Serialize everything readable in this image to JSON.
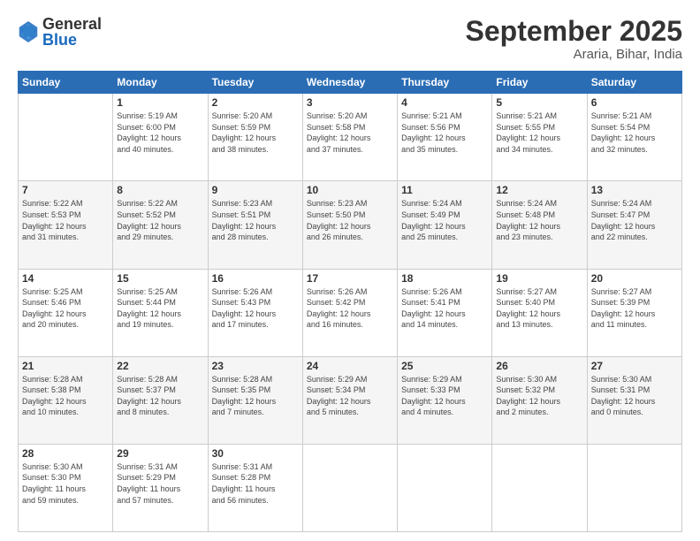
{
  "header": {
    "logo": {
      "general": "General",
      "blue": "Blue"
    },
    "title": "September 2025",
    "location": "Araria, Bihar, India"
  },
  "calendar": {
    "days_of_week": [
      "Sunday",
      "Monday",
      "Tuesday",
      "Wednesday",
      "Thursday",
      "Friday",
      "Saturday"
    ],
    "weeks": [
      [
        {
          "day": "",
          "info": ""
        },
        {
          "day": "1",
          "info": "Sunrise: 5:19 AM\nSunset: 6:00 PM\nDaylight: 12 hours\nand 40 minutes."
        },
        {
          "day": "2",
          "info": "Sunrise: 5:20 AM\nSunset: 5:59 PM\nDaylight: 12 hours\nand 38 minutes."
        },
        {
          "day": "3",
          "info": "Sunrise: 5:20 AM\nSunset: 5:58 PM\nDaylight: 12 hours\nand 37 minutes."
        },
        {
          "day": "4",
          "info": "Sunrise: 5:21 AM\nSunset: 5:56 PM\nDaylight: 12 hours\nand 35 minutes."
        },
        {
          "day": "5",
          "info": "Sunrise: 5:21 AM\nSunset: 5:55 PM\nDaylight: 12 hours\nand 34 minutes."
        },
        {
          "day": "6",
          "info": "Sunrise: 5:21 AM\nSunset: 5:54 PM\nDaylight: 12 hours\nand 32 minutes."
        }
      ],
      [
        {
          "day": "7",
          "info": "Sunrise: 5:22 AM\nSunset: 5:53 PM\nDaylight: 12 hours\nand 31 minutes."
        },
        {
          "day": "8",
          "info": "Sunrise: 5:22 AM\nSunset: 5:52 PM\nDaylight: 12 hours\nand 29 minutes."
        },
        {
          "day": "9",
          "info": "Sunrise: 5:23 AM\nSunset: 5:51 PM\nDaylight: 12 hours\nand 28 minutes."
        },
        {
          "day": "10",
          "info": "Sunrise: 5:23 AM\nSunset: 5:50 PM\nDaylight: 12 hours\nand 26 minutes."
        },
        {
          "day": "11",
          "info": "Sunrise: 5:24 AM\nSunset: 5:49 PM\nDaylight: 12 hours\nand 25 minutes."
        },
        {
          "day": "12",
          "info": "Sunrise: 5:24 AM\nSunset: 5:48 PM\nDaylight: 12 hours\nand 23 minutes."
        },
        {
          "day": "13",
          "info": "Sunrise: 5:24 AM\nSunset: 5:47 PM\nDaylight: 12 hours\nand 22 minutes."
        }
      ],
      [
        {
          "day": "14",
          "info": "Sunrise: 5:25 AM\nSunset: 5:46 PM\nDaylight: 12 hours\nand 20 minutes."
        },
        {
          "day": "15",
          "info": "Sunrise: 5:25 AM\nSunset: 5:44 PM\nDaylight: 12 hours\nand 19 minutes."
        },
        {
          "day": "16",
          "info": "Sunrise: 5:26 AM\nSunset: 5:43 PM\nDaylight: 12 hours\nand 17 minutes."
        },
        {
          "day": "17",
          "info": "Sunrise: 5:26 AM\nSunset: 5:42 PM\nDaylight: 12 hours\nand 16 minutes."
        },
        {
          "day": "18",
          "info": "Sunrise: 5:26 AM\nSunset: 5:41 PM\nDaylight: 12 hours\nand 14 minutes."
        },
        {
          "day": "19",
          "info": "Sunrise: 5:27 AM\nSunset: 5:40 PM\nDaylight: 12 hours\nand 13 minutes."
        },
        {
          "day": "20",
          "info": "Sunrise: 5:27 AM\nSunset: 5:39 PM\nDaylight: 12 hours\nand 11 minutes."
        }
      ],
      [
        {
          "day": "21",
          "info": "Sunrise: 5:28 AM\nSunset: 5:38 PM\nDaylight: 12 hours\nand 10 minutes."
        },
        {
          "day": "22",
          "info": "Sunrise: 5:28 AM\nSunset: 5:37 PM\nDaylight: 12 hours\nand 8 minutes."
        },
        {
          "day": "23",
          "info": "Sunrise: 5:28 AM\nSunset: 5:35 PM\nDaylight: 12 hours\nand 7 minutes."
        },
        {
          "day": "24",
          "info": "Sunrise: 5:29 AM\nSunset: 5:34 PM\nDaylight: 12 hours\nand 5 minutes."
        },
        {
          "day": "25",
          "info": "Sunrise: 5:29 AM\nSunset: 5:33 PM\nDaylight: 12 hours\nand 4 minutes."
        },
        {
          "day": "26",
          "info": "Sunrise: 5:30 AM\nSunset: 5:32 PM\nDaylight: 12 hours\nand 2 minutes."
        },
        {
          "day": "27",
          "info": "Sunrise: 5:30 AM\nSunset: 5:31 PM\nDaylight: 12 hours\nand 0 minutes."
        }
      ],
      [
        {
          "day": "28",
          "info": "Sunrise: 5:30 AM\nSunset: 5:30 PM\nDaylight: 11 hours\nand 59 minutes."
        },
        {
          "day": "29",
          "info": "Sunrise: 5:31 AM\nSunset: 5:29 PM\nDaylight: 11 hours\nand 57 minutes."
        },
        {
          "day": "30",
          "info": "Sunrise: 5:31 AM\nSunset: 5:28 PM\nDaylight: 11 hours\nand 56 minutes."
        },
        {
          "day": "",
          "info": ""
        },
        {
          "day": "",
          "info": ""
        },
        {
          "day": "",
          "info": ""
        },
        {
          "day": "",
          "info": ""
        }
      ]
    ]
  }
}
